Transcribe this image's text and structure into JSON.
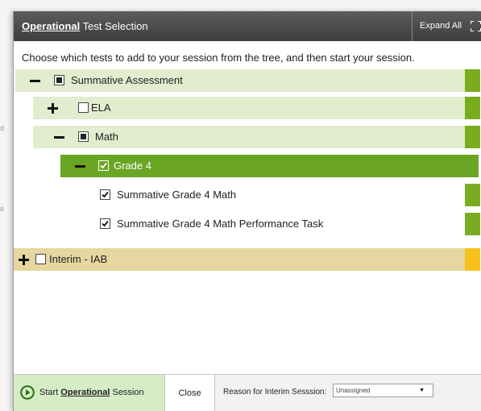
{
  "background": {
    "marks": [
      "d",
      "e"
    ]
  },
  "dialog": {
    "title_bold": "Operational",
    "title_rest": " Test Selection",
    "expand_all_label": "Expand All",
    "expand_icon": "expand-arrows-icon",
    "instructions": "Choose which tests to add to your session from the tree, and then start your session."
  },
  "tree": {
    "summative": {
      "label": "Summative Assessment",
      "toggle": "collapse",
      "checkbox": "partial"
    },
    "ela": {
      "label": "ELA",
      "toggle": "expand",
      "checkbox": "unchecked"
    },
    "math": {
      "label": "Math",
      "toggle": "collapse",
      "checkbox": "partial"
    },
    "grade4": {
      "label": "Grade 4",
      "toggle": "collapse",
      "checkbox": "checked"
    },
    "test1": {
      "label": "Summative Grade 4 Math",
      "checkbox": "checked"
    },
    "test2": {
      "label": "Summative Grade 4 Math Performance Task",
      "checkbox": "checked"
    },
    "interim": {
      "label": "Interim - IAB",
      "toggle": "expand",
      "checkbox": "unchecked"
    }
  },
  "footer": {
    "start_prefix": "Start ",
    "start_bold": "Operational",
    "start_suffix": " Session",
    "close_label": "Close",
    "reason_label": "Reason for Interim Sesssion:",
    "reason_value": "Unassigned"
  },
  "colors": {
    "row_light_green": "#e2ecce",
    "accent_green": "#7aac20",
    "selected_green": "#6aa524",
    "interim_tan": "#e6d7a0",
    "interim_accent": "#f6c21a",
    "start_button_bg": "#d6ecc6",
    "title_bar": "#4a4a4a"
  }
}
